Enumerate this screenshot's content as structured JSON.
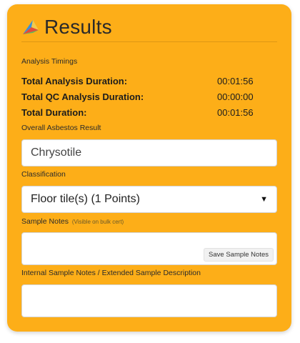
{
  "header": {
    "title": "Results",
    "logo_icon": "brand-logo-icon"
  },
  "timings": {
    "label": "Analysis Timings",
    "rows": [
      {
        "label": "Total Analysis Duration:",
        "value": "00:01:56"
      },
      {
        "label": "Total QC Analysis Duration:",
        "value": "00:00:00"
      },
      {
        "label": "Total Duration:",
        "value": "00:01:56"
      }
    ]
  },
  "asbestos": {
    "label": "Overall Asbestos Result",
    "value": "Chrysotile"
  },
  "classification": {
    "label": "Classification",
    "selected": "Floor tile(s) (1 Points)"
  },
  "sample_notes": {
    "label": "Sample Notes",
    "hint": "(Visible on bulk cert)",
    "save_label": "Save Sample Notes"
  },
  "internal_notes": {
    "label": "Internal Sample Notes / Extended Sample Description"
  },
  "colors": {
    "card": "#fdae18",
    "field": "#ffffff"
  }
}
